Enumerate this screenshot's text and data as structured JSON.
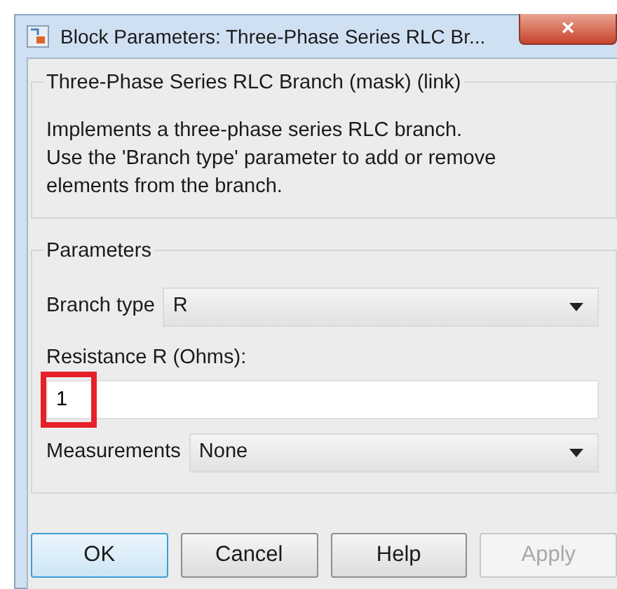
{
  "window": {
    "title": "Block Parameters: Three-Phase Series RLC Br...",
    "close": "×"
  },
  "description_group": {
    "title": "Three-Phase Series RLC Branch (mask) (link)",
    "text": "Implements a three-phase series RLC branch.\nUse the 'Branch type' parameter to add or remove elements from the branch."
  },
  "parameters_group": {
    "title": "Parameters",
    "fields": [
      {
        "kind": "dropdown",
        "label": "Branch type",
        "value": "R"
      },
      {
        "kind": "text",
        "label": "Resistance R (Ohms):",
        "value": "1",
        "highlighted": true
      },
      {
        "kind": "dropdown",
        "label": "Measurements",
        "value": "None"
      }
    ]
  },
  "buttons": [
    {
      "label": "OK",
      "default": true,
      "disabled": false
    },
    {
      "label": "Cancel",
      "default": false,
      "disabled": false
    },
    {
      "label": "Help",
      "default": false,
      "disabled": false
    },
    {
      "label": "Apply",
      "default": false,
      "disabled": true
    }
  ]
}
